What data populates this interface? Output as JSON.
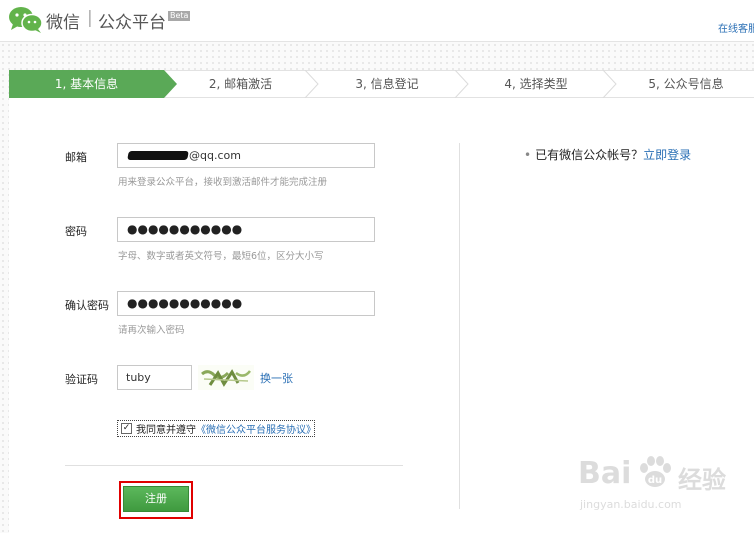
{
  "header": {
    "brand_name": "微信",
    "brand_separator": "|",
    "brand_product": "公众平台",
    "beta_label": "Beta",
    "support_link": "在线客服"
  },
  "steps": [
    {
      "label": "1, 基本信息",
      "active": true
    },
    {
      "label": "2, 邮箱激活",
      "active": false
    },
    {
      "label": "3, 信息登记",
      "active": false
    },
    {
      "label": "4, 选择类型",
      "active": false
    },
    {
      "label": "5, 公众号信息",
      "active": false
    }
  ],
  "form": {
    "email": {
      "label": "邮箱",
      "value_suffix": "@qq.com",
      "hint": "用来登录公众平台，接收到激活邮件才能完成注册"
    },
    "password": {
      "label": "密码",
      "value_masked": "●●●●●●●●●●●",
      "hint": "字母、数字或者英文符号，最短6位，区分大小写"
    },
    "confirm_password": {
      "label": "确认密码",
      "value_masked": "●●●●●●●●●●●",
      "hint": "请再次输入密码"
    },
    "captcha": {
      "label": "验证码",
      "value": "tuby",
      "refresh_link": "换一张"
    },
    "agreement": {
      "checked": true,
      "text": "我同意并遵守",
      "link": "《微信公众平台服务协议》"
    },
    "submit_label": "注册"
  },
  "sidebar": {
    "prompt": "已有微信公众帐号？",
    "login_link": "立即登录"
  },
  "watermark": {
    "brand": "Bai",
    "brand_suffix": "经验",
    "url": "jingyan.baidu.com"
  },
  "colors": {
    "accent_green": "#5aa957",
    "link_blue": "#2a6fb5",
    "highlight_red": "#e00000"
  }
}
